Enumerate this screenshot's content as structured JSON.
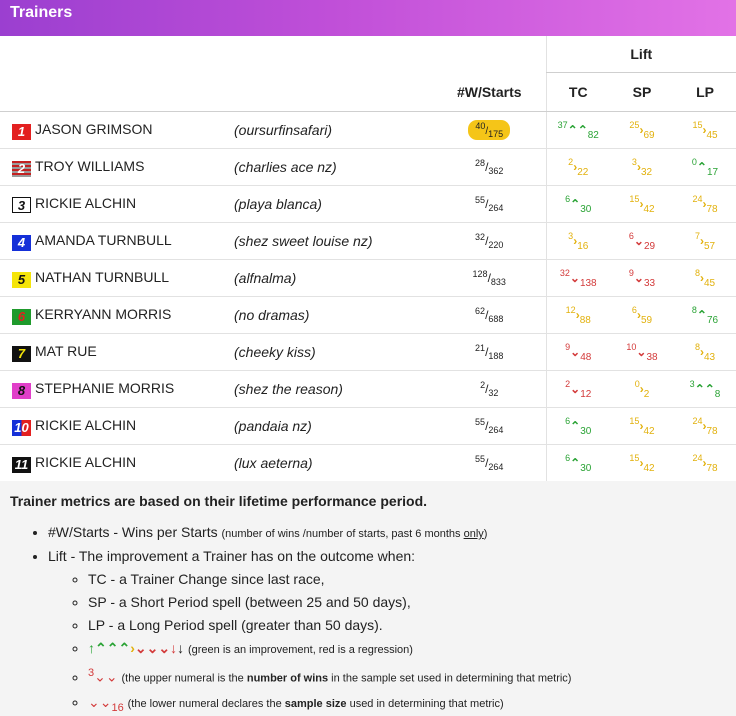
{
  "header": {
    "title": "Trainers"
  },
  "table": {
    "lift_label": "Lift",
    "columns": {
      "ws": "#W/Starts",
      "tc": "TC",
      "sp": "SP",
      "lp": "LP"
    },
    "rows": [
      {
        "num": "1",
        "trainer": "JASON GRIMSON",
        "horse": "(oursurfinsafari)",
        "wins": "40",
        "starts": "175",
        "tc": {
          "w": "37",
          "s": "82",
          "arrow": "⌃⌃",
          "color": "green"
        },
        "sp": {
          "w": "25",
          "s": "69",
          "arrow": "›",
          "color": "yellow"
        },
        "lp": {
          "w": "15",
          "s": "45",
          "arrow": "›",
          "color": "yellow"
        }
      },
      {
        "num": "2",
        "trainer": "TROY WILLIAMS",
        "horse": "(charlies ace nz)",
        "wins": "28",
        "starts": "362",
        "tc": {
          "w": "2",
          "s": "22",
          "arrow": "›",
          "color": "yellow"
        },
        "sp": {
          "w": "3",
          "s": "32",
          "arrow": "›",
          "color": "yellow"
        },
        "lp": {
          "w": "0",
          "s": "17",
          "arrow": "⌃",
          "color": "green"
        }
      },
      {
        "num": "3",
        "trainer": "RICKIE ALCHIN",
        "horse": "(playa blanca)",
        "wins": "55",
        "starts": "264",
        "tc": {
          "w": "6",
          "s": "30",
          "arrow": "⌃",
          "color": "green"
        },
        "sp": {
          "w": "15",
          "s": "42",
          "arrow": "›",
          "color": "yellow"
        },
        "lp": {
          "w": "24",
          "s": "78",
          "arrow": "›",
          "color": "yellow"
        }
      },
      {
        "num": "4",
        "trainer": "AMANDA TURNBULL",
        "horse": "(shez sweet louise nz)",
        "wins": "32",
        "starts": "220",
        "tc": {
          "w": "3",
          "s": "16",
          "arrow": "›",
          "color": "yellow"
        },
        "sp": {
          "w": "6",
          "s": "29",
          "arrow": "⌄",
          "color": "red"
        },
        "lp": {
          "w": "7",
          "s": "57",
          "arrow": "›",
          "color": "yellow"
        }
      },
      {
        "num": "5",
        "trainer": "NATHAN TURNBULL",
        "horse": "(alfnalma)",
        "wins": "128",
        "starts": "833",
        "tc": {
          "w": "32",
          "s": "138",
          "arrow": "⌄",
          "color": "red"
        },
        "sp": {
          "w": "9",
          "s": "33",
          "arrow": "⌄",
          "color": "red"
        },
        "lp": {
          "w": "8",
          "s": "45",
          "arrow": "›",
          "color": "yellow"
        }
      },
      {
        "num": "6",
        "trainer": "KERRYANN MORRIS",
        "horse": "(no dramas)",
        "wins": "62",
        "starts": "688",
        "tc": {
          "w": "12",
          "s": "88",
          "arrow": "›",
          "color": "yellow"
        },
        "sp": {
          "w": "6",
          "s": "59",
          "arrow": "›",
          "color": "yellow"
        },
        "lp": {
          "w": "8",
          "s": "76",
          "arrow": "⌃",
          "color": "green"
        }
      },
      {
        "num": "7",
        "trainer": "MAT RUE",
        "horse": "(cheeky kiss)",
        "wins": "21",
        "starts": "188",
        "tc": {
          "w": "9",
          "s": "48",
          "arrow": "⌄",
          "color": "red"
        },
        "sp": {
          "w": "10",
          "s": "38",
          "arrow": "⌄",
          "color": "red"
        },
        "lp": {
          "w": "8",
          "s": "43",
          "arrow": "›",
          "color": "yellow"
        }
      },
      {
        "num": "8",
        "trainer": "STEPHANIE MORRIS",
        "horse": "(shez the reason)",
        "wins": "2",
        "starts": "32",
        "tc": {
          "w": "2",
          "s": "12",
          "arrow": "⌄",
          "color": "red"
        },
        "sp": {
          "w": "0",
          "s": "2",
          "arrow": "›",
          "color": "yellow"
        },
        "lp": {
          "w": "3",
          "s": "8",
          "arrow": "⌃⌃",
          "color": "green"
        }
      },
      {
        "num": "10",
        "trainer": "RICKIE ALCHIN",
        "horse": "(pandaia nz)",
        "wins": "55",
        "starts": "264",
        "tc": {
          "w": "6",
          "s": "30",
          "arrow": "⌃",
          "color": "green"
        },
        "sp": {
          "w": "15",
          "s": "42",
          "arrow": "›",
          "color": "yellow"
        },
        "lp": {
          "w": "24",
          "s": "78",
          "arrow": "›",
          "color": "yellow"
        }
      },
      {
        "num": "11",
        "trainer": "RICKIE ALCHIN",
        "horse": "(lux aeterna)",
        "wins": "55",
        "starts": "264",
        "tc": {
          "w": "6",
          "s": "30",
          "arrow": "⌃",
          "color": "green"
        },
        "sp": {
          "w": "15",
          "s": "42",
          "arrow": "›",
          "color": "yellow"
        },
        "lp": {
          "w": "24",
          "s": "78",
          "arrow": "›",
          "color": "yellow"
        }
      }
    ]
  },
  "colors": {
    "green": "#2aa335",
    "red": "#d33a3a",
    "yellow": "#e2b10d",
    "highlight": "#f5c518"
  },
  "notes": {
    "title": "Trainer metrics are based on their lifetime performance period.",
    "ws_main": "#W/Starts - Wins per Starts",
    "ws_small_a": "(number of wins /number of starts, past 6 months ",
    "ws_small_only": "only",
    "ws_small_b": ")",
    "lift_main": "Lift - The improvement a Trainer has on the outcome when:",
    "tc": "TC - a Trainer Change since last race,",
    "sp": "SP - a Short Period spell (between 25 and 50 days),",
    "lp": "LP - a Long Period spell (greater than 50 days).",
    "legend_text": "(green is an improvement, red is a regression)",
    "upper_example": "3",
    "upper_a": "(the upper numeral is the ",
    "upper_bold": "number of wins",
    "upper_b": " in the sample set used in determining that metric)",
    "lower_example": "16",
    "lower_a": "(the lower numeral declares the ",
    "lower_bold": "sample size",
    "lower_b": " used in determining that metric)"
  }
}
